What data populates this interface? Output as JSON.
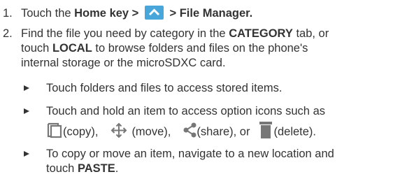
{
  "steps": [
    {
      "number": "1.",
      "parts": {
        "pre": "Touch the ",
        "bold1": "Home",
        "mid": " key > ",
        "after_icon": " > ",
        "bold2": "File Manager",
        "end": "."
      }
    },
    {
      "number": "2.",
      "line1_pre": "Find the file you need by category in the ",
      "line1_bold": "CATEGORY",
      "line1_post": " tab, or",
      "line2_pre": "touch ",
      "line2_bold": "LOCAL",
      "line2_post": " to browse folders and files on the phone's",
      "line3": "internal storage or the microSDXC card."
    }
  ],
  "bullets": [
    {
      "text": "Touch folders and files to access stored items."
    },
    {
      "line1": "Touch and hold an item to access option icons such as",
      "copy_label": "(copy),",
      "move_label": "(move),",
      "share_label": "(share), or",
      "delete_label": "(delete)."
    },
    {
      "line1": "To copy or move an item, navigate to a new location and",
      "line2_pre": "touch ",
      "line2_bold": "PASTE",
      "line2_post": "."
    }
  ],
  "icons": {
    "home_key": "home-key-chevron-up-icon",
    "copy": "copy-icon",
    "move": "move-icon",
    "share": "share-icon",
    "delete": "delete-icon",
    "bullet": "triangle-bullet-icon"
  },
  "colors": {
    "text": "#333333",
    "home_key_bg": "#49a6da",
    "icon_gray": "#777777"
  }
}
